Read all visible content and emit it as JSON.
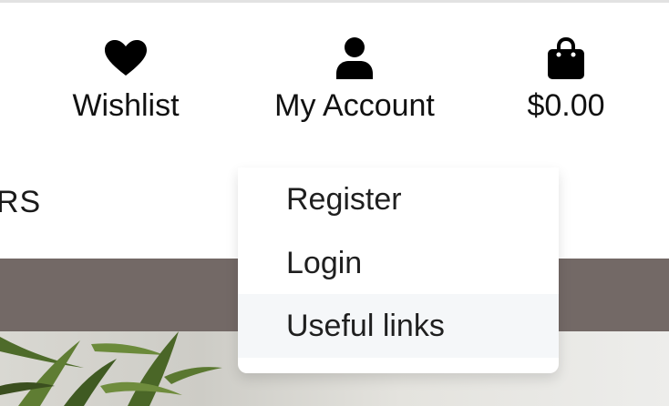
{
  "header": {
    "wishlist": {
      "label": "Wishlist",
      "icon": "heart-icon"
    },
    "account": {
      "label": "My Account",
      "icon": "user-icon"
    },
    "cart": {
      "label": "$0.00",
      "icon": "shopping-bag-icon"
    }
  },
  "nav": {
    "partial_label": "RS"
  },
  "account_menu": {
    "items": [
      {
        "label": "Register"
      },
      {
        "label": "Login"
      },
      {
        "label": "Useful links",
        "highlighted": true
      }
    ]
  },
  "colors": {
    "banner": "#736966",
    "menu_hover": "#f5f7f9",
    "text": "#111111"
  }
}
